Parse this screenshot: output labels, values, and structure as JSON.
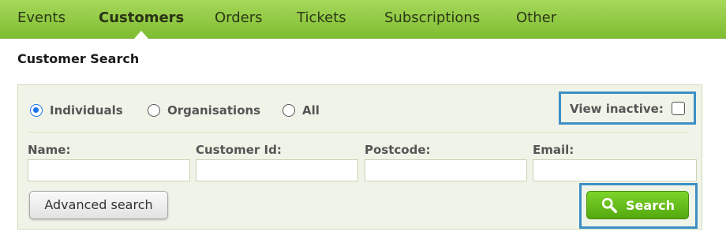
{
  "nav": {
    "items": [
      {
        "label": "Events"
      },
      {
        "label": "Customers"
      },
      {
        "label": "Orders"
      },
      {
        "label": "Tickets"
      },
      {
        "label": "Subscriptions"
      },
      {
        "label": "Other"
      }
    ],
    "active": "Customers"
  },
  "page": {
    "title": "Customer Search"
  },
  "search": {
    "types": [
      {
        "label": "Individuals",
        "checked": true
      },
      {
        "label": "Organisations",
        "checked": false
      },
      {
        "label": "All",
        "checked": false
      }
    ],
    "view_inactive": {
      "label": "View inactive:",
      "checked": false
    },
    "fields": [
      {
        "label": "Name:",
        "value": ""
      },
      {
        "label": "Customer Id:",
        "value": ""
      },
      {
        "label": "Postcode:",
        "value": ""
      },
      {
        "label": "Email:",
        "value": ""
      }
    ],
    "advanced_label": "Advanced search",
    "search_label": "Search"
  },
  "colors": {
    "nav_green": "#8cc63f",
    "search_green": "#66bb1b",
    "highlight_blue": "#3d8fc7",
    "radio_blue": "#1a73e8"
  }
}
